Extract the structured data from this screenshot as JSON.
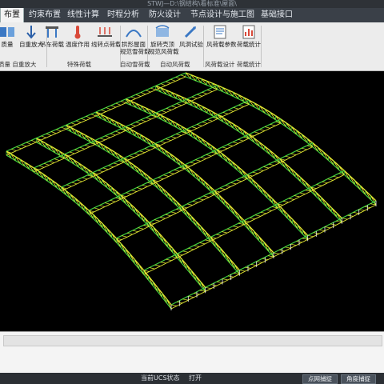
{
  "window": {
    "title": "STWJ—D:\\钢结构\\看标准\\屋面\\"
  },
  "menu": {
    "tabs": [
      {
        "label": "布置",
        "active": true
      },
      {
        "label": "约束布置",
        "active": false
      },
      {
        "label": "线性计算",
        "active": false
      },
      {
        "label": "时程分析",
        "active": false
      },
      {
        "label": "防火设计",
        "active": false
      },
      {
        "label": "节点设计与施工图",
        "active": false
      },
      {
        "label": "基础接口",
        "active": false
      }
    ]
  },
  "ribbon": {
    "buttons": [
      {
        "label": "质量",
        "label2": ""
      },
      {
        "label": "自重放大",
        "label2": ""
      },
      {
        "label": "吊车荷载",
        "label2": ""
      },
      {
        "label": "温度作用",
        "label2": ""
      },
      {
        "label": "线转点荷载",
        "label2": ""
      },
      {
        "label": "拱形屋面",
        "label2": "规范雪荷载"
      },
      {
        "label": "旋转壳顶",
        "label2": "规范风荷载"
      },
      {
        "label": "风洞试验",
        "label2": ""
      },
      {
        "label": "风荷载参数",
        "label2": ""
      },
      {
        "label": "荷载统计",
        "label2": ""
      }
    ],
    "groups": [
      {
        "label": "质量 自重放大"
      },
      {
        "label": "特殊荷载"
      },
      {
        "label": "自动雪荷载"
      },
      {
        "label": "自动风荷载"
      },
      {
        "label": "风荷载设计"
      },
      {
        "label": "荷载统计"
      }
    ]
  },
  "status": {
    "ucs_label": "当前UCS状态",
    "ucs_value": "打开",
    "snap_button": "点网捕捉",
    "angle_button": "角度捕捉"
  }
}
